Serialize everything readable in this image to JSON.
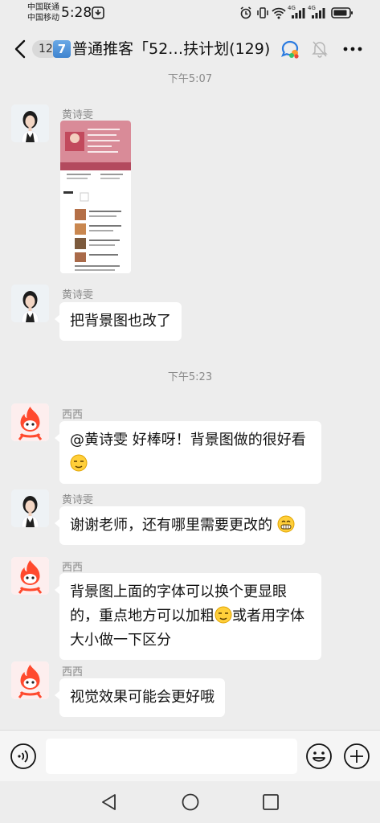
{
  "status": {
    "carrier1": "中国联通",
    "carrier2": "中国移动",
    "time": "5:28",
    "network1": "4G",
    "network2": "4G"
  },
  "header": {
    "unread": "12",
    "badge": "7",
    "title": "普通推客「52…扶计划(129)"
  },
  "messages": {
    "time1": "下午5:07",
    "time2": "下午5:23",
    "m1_sender": "黄诗雯",
    "m2_sender": "黄诗雯",
    "m2_text": "把背景图也改了",
    "m3_sender": "西西",
    "m3_text": "@黄诗雯 好棒呀！背景图做的很好看",
    "m4_sender": "黄诗雯",
    "m4_text": "谢谢老师，还有哪里需要更改的",
    "m5_sender": "西西",
    "m5_text_a": "背景图上面的字体可以换个更显眼的，重点地方可以加粗",
    "m5_text_b": "或者用字体大小做一下区分",
    "m6_sender": "西西",
    "m6_text": "视觉效果可能会更好哦"
  },
  "icons": {
    "back": "chevron-left-icon",
    "group": "group-chat-icon",
    "mute": "bell-muted-icon",
    "more": "more-icon",
    "voice": "voice-icon",
    "emoji": "emoji-icon",
    "plus": "plus-icon"
  },
  "colors": {
    "background": "#ededed",
    "bubble": "#ffffff",
    "badge_blue": "#3f84cf",
    "avatar_red": "#ff4a2e"
  }
}
